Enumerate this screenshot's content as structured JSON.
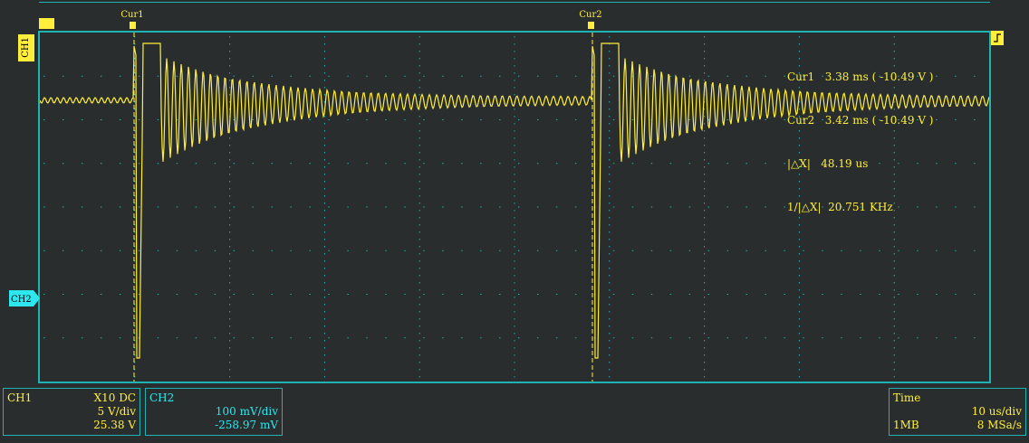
{
  "cursors": [
    {
      "label": "Cur1"
    },
    {
      "label": "Cur2"
    }
  ],
  "markers": {
    "ch1": "CH1",
    "ch2": "CH2"
  },
  "measurements": {
    "cur1": "Cur1   3.38 ms ( -10.49 V )",
    "cur2": "Cur2   3.42 ms ( -10.49 V )",
    "delta_x": "|△X|   48.19 us",
    "inv_delta_x": "1/|△X|  20.751 KHz"
  },
  "panels": {
    "ch1": {
      "name": "CH1",
      "coupling": "X10  DC",
      "scale": "5 V/div",
      "offset": "25.38 V"
    },
    "ch2": {
      "name": "CH2",
      "scale": "100 mV/div",
      "offset": "-258.97 mV"
    },
    "time": {
      "name": "Time",
      "scale": "10 us/div",
      "memory": "1MB",
      "rate": "8 MSa/s"
    }
  },
  "colors": {
    "ch1": "#ffef3a",
    "ch2": "#2ee7ee",
    "grid": "#1fb3b3"
  }
}
